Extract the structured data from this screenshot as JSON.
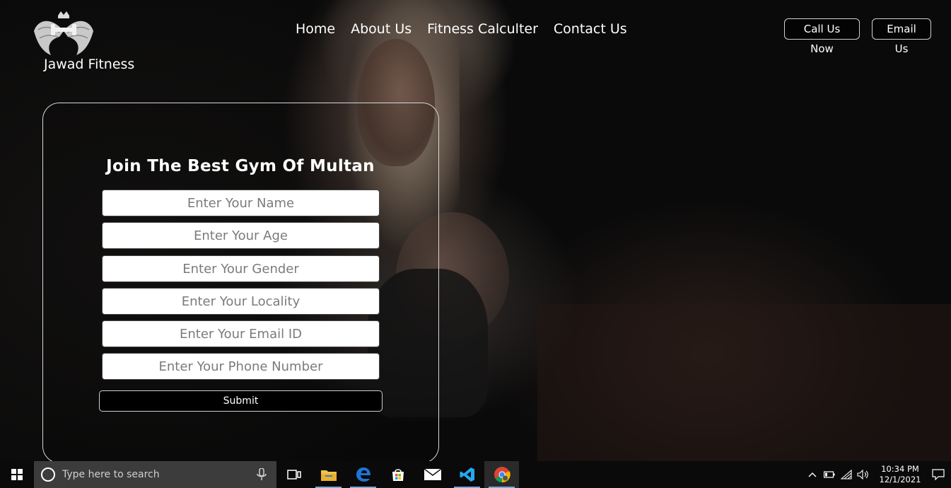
{
  "brand": {
    "name": "Jawad Fitness",
    "logo_icon": "winged-dumbbell-logo"
  },
  "nav": {
    "items": [
      {
        "label": "Home"
      },
      {
        "label": "About Us"
      },
      {
        "label": "Fitness Calculter"
      },
      {
        "label": "Contact Us"
      }
    ]
  },
  "header_buttons": {
    "call": "Call Us Now",
    "email": "Email Us"
  },
  "form": {
    "title": "Join The Best Gym Of Multan",
    "fields": [
      {
        "placeholder": "Enter Your Name",
        "value": ""
      },
      {
        "placeholder": "Enter Your Age",
        "value": ""
      },
      {
        "placeholder": "Enter Your Gender",
        "value": ""
      },
      {
        "placeholder": "Enter Your Locality",
        "value": ""
      },
      {
        "placeholder": "Enter Your Email ID",
        "value": ""
      },
      {
        "placeholder": "Enter Your Phone Number",
        "value": ""
      }
    ],
    "submit_label": "Submit"
  },
  "taskbar": {
    "search_placeholder": "Type here to search",
    "apps": [
      "task-view-icon",
      "file-explorer-icon",
      "edge-icon",
      "store-icon",
      "mail-icon",
      "vscode-icon",
      "chrome-icon"
    ],
    "active_app": "chrome-icon",
    "clock_time": "10:34 PM",
    "clock_date": "12/1/2021"
  },
  "colors": {
    "accent_blue": "#0078d7",
    "card_border": "#d8d8d8"
  }
}
